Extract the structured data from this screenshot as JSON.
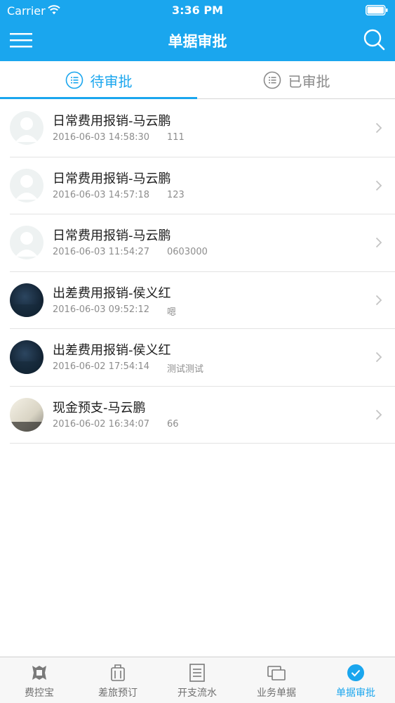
{
  "status_bar": {
    "carrier": "Carrier",
    "time": "3:36 PM"
  },
  "nav": {
    "title": "单据审批",
    "menu_icon": "menu-icon",
    "search_icon": "search-icon"
  },
  "tabs": [
    {
      "label": "待审批",
      "icon": "list-circle-icon",
      "active": true
    },
    {
      "label": "已审批",
      "icon": "list-circle-icon",
      "active": false
    }
  ],
  "items": [
    {
      "title": "日常费用报销-马云鹏",
      "time": "2016-06-03 14:58:30",
      "note": "111",
      "avatar": "placeholder"
    },
    {
      "title": "日常费用报销-马云鹏",
      "time": "2016-06-03 14:57:18",
      "note": "123",
      "avatar": "placeholder"
    },
    {
      "title": "日常费用报销-马云鹏",
      "time": "2016-06-03 11:54:27",
      "note": "0603000",
      "avatar": "placeholder"
    },
    {
      "title": "出差费用报销-侯义红",
      "time": "2016-06-03 09:52:12",
      "note": "嗯",
      "avatar": "dark-photo"
    },
    {
      "title": "出差费用报销-侯义红",
      "time": "2016-06-02 17:54:14",
      "note": "测试测试",
      "avatar": "dark-photo"
    },
    {
      "title": "现金预支-马云鹏",
      "time": "2016-06-02 16:34:07",
      "note": "66",
      "avatar": "light-photo"
    }
  ],
  "tabbar": [
    {
      "label": "费控宝",
      "icon": "badge-icon",
      "active": false
    },
    {
      "label": "差旅预订",
      "icon": "luggage-icon",
      "active": false
    },
    {
      "label": "开支流水",
      "icon": "ledger-icon",
      "active": false
    },
    {
      "label": "业务单据",
      "icon": "documents-icon",
      "active": false
    },
    {
      "label": "单据审批",
      "icon": "check-circle-icon",
      "active": true
    }
  ],
  "colors": {
    "primary": "#1aa6ee",
    "inactive": "#8a8a8a",
    "tabbar_bg": "#f7f7f7"
  }
}
